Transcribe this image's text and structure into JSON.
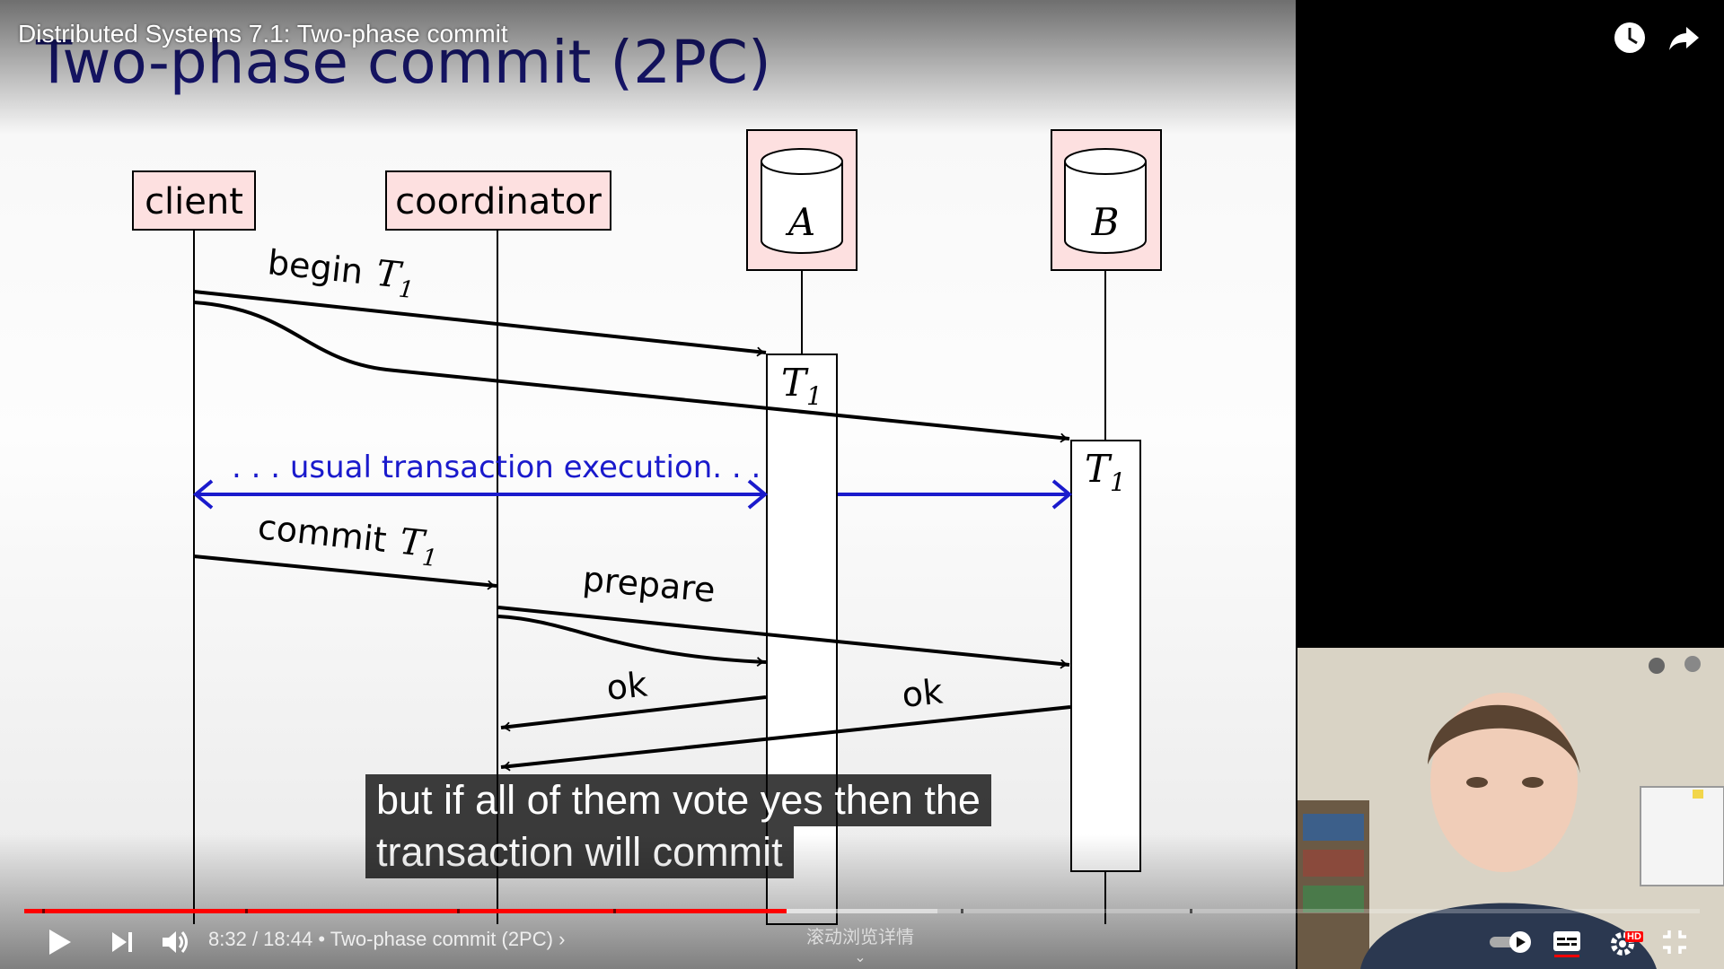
{
  "video": {
    "title": "Distributed Systems 7.1: Two-phase commit",
    "time_current": "8:32",
    "time_total": "18:44",
    "chapter": "Two-phase commit (2PC)",
    "chapter_hint": "滚动浏览详情",
    "progress_played": 0.455,
    "progress_loaded": 0.545,
    "quality_badge": "HD"
  },
  "slide": {
    "title": "Two-phase commit (2PC)",
    "nodes": [
      "client",
      "coordinator",
      "A",
      "B"
    ],
    "messages": {
      "begin": "begin",
      "commit": "commit",
      "prepare": "prepare",
      "ok_a": "ok",
      "ok_b": "ok"
    },
    "transaction_name": "T",
    "transaction_sub": "1",
    "execution_label": ". . . usual transaction execution. . ."
  },
  "captions": {
    "line1": "but if all of them vote yes then the",
    "line2": "transaction will commit"
  },
  "icons": {
    "watch_later": "clock-icon",
    "share": "share-icon",
    "play": "play-icon",
    "next": "next-icon",
    "volume": "volume-icon",
    "autoplay": "autoplay-toggle-icon",
    "subtitles": "subtitles-icon",
    "settings": "gear-icon",
    "exit_fullscreen": "exit-fullscreen-icon"
  },
  "colors": {
    "accent_red": "#ff0000",
    "slide_title_blue": "#1b1a80",
    "box_fill": "#fde0e0",
    "execution_blue": "#1a1acc"
  }
}
